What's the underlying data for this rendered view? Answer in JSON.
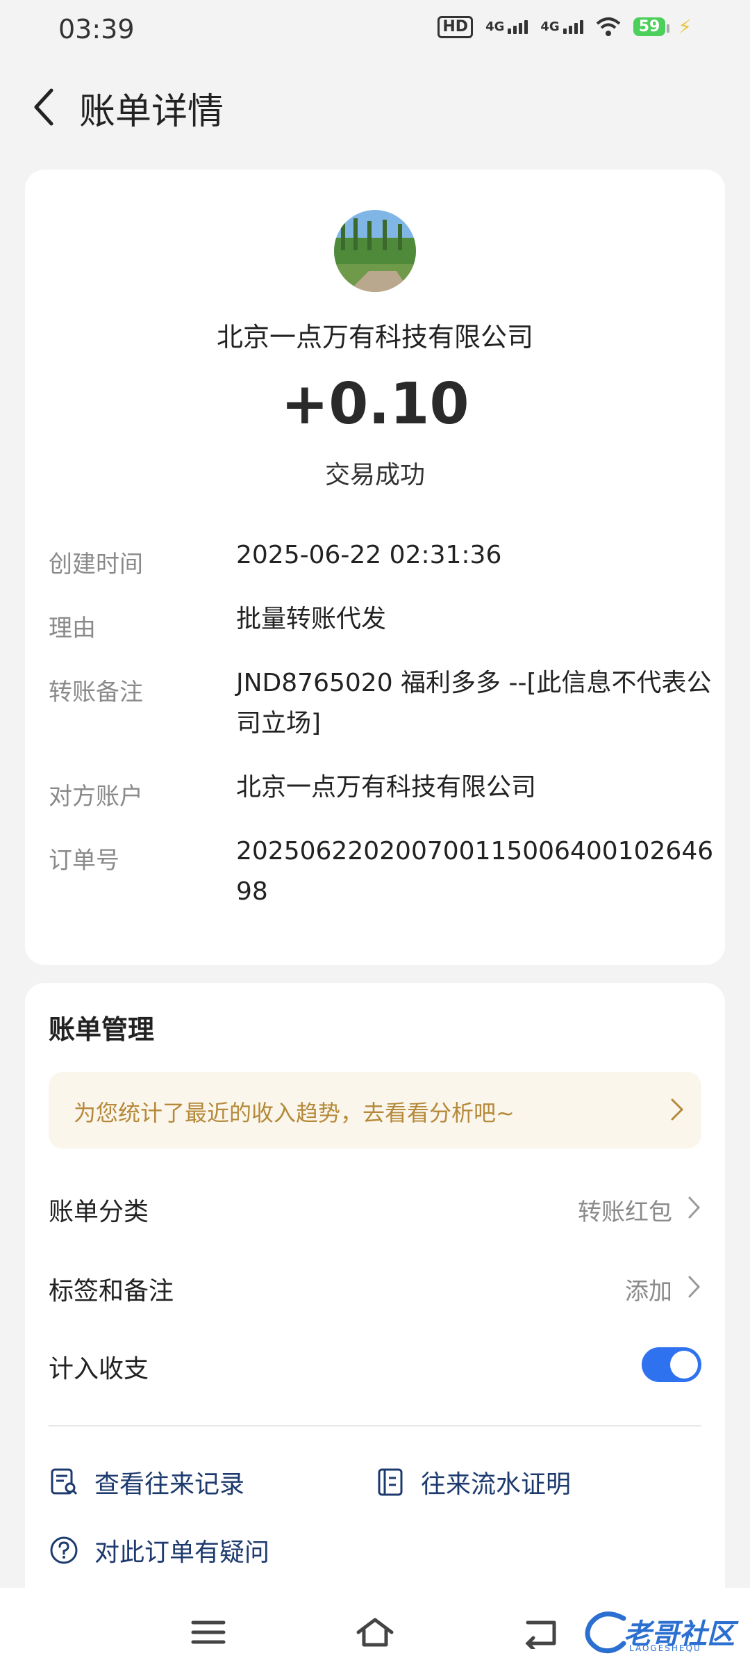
{
  "status_bar": {
    "time": "03:39",
    "hd_label": "HD",
    "net1_label": "4G",
    "net2_label": "4G",
    "battery": "59",
    "icons": [
      "hd-icon",
      "signal-icon",
      "signal-icon",
      "wifi-icon",
      "battery-icon",
      "charging-icon"
    ]
  },
  "header": {
    "title": "账单详情",
    "back_icon": "chevron-left-icon"
  },
  "bill": {
    "merchant": "北京一点万有科技有限公司",
    "amount": "+0.10",
    "status": "交易成功",
    "details": [
      {
        "label": "创建时间",
        "value": "2025-06-22 02:31:36"
      },
      {
        "label": "理由",
        "value": "批量转账代发"
      },
      {
        "label": "转账备注",
        "value": "JND8765020 福利多多 --[此信息不代表公司立场]"
      },
      {
        "label": "对方账户",
        "value": "北京一点万有科技有限公司"
      },
      {
        "label": "订单号",
        "value": "202506220200700115006400102646 98"
      }
    ]
  },
  "management": {
    "title": "账单管理",
    "tip": "为您统计了最近的收入趋势，去看看分析吧~",
    "category_label": "账单分类",
    "category_value": "转账红包",
    "tags_label": "标签和备注",
    "tags_value": "添加",
    "include_label": "计入收支",
    "include_enabled": true,
    "links": [
      {
        "label": "查看往来记录",
        "icon": "record-search-icon"
      },
      {
        "label": "往来流水证明",
        "icon": "statement-icon"
      },
      {
        "label": "对此订单有疑问",
        "icon": "question-icon"
      }
    ]
  },
  "navbar": {
    "icons": [
      "menu-icon",
      "home-icon",
      "back-icon"
    ],
    "watermark": "老哥社区",
    "watermark_sub": "LAOGESHEQU"
  },
  "colors": {
    "accent": "#2f72f0",
    "tip_bg": "#fbf6ec",
    "tip_text": "#b5893a",
    "link_text": "#1d3a6e"
  }
}
